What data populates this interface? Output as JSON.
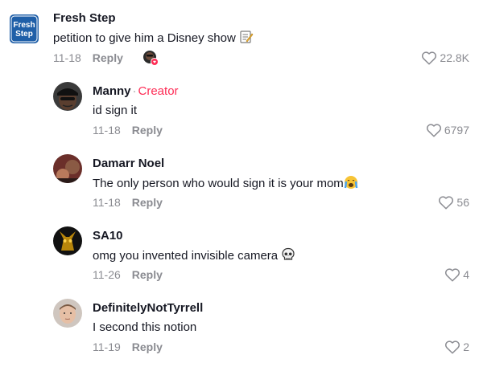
{
  "comments": [
    {
      "user": "Fresh Step",
      "avatar": "fresh-step-logo",
      "logo_text": [
        "Fresh",
        "Step"
      ],
      "text": "petition to give him a Disney show",
      "emoji": "memo-emoji",
      "date": "11-18",
      "reply_label": "Reply",
      "likes": "22.8K",
      "liked_by_creator": true
    },
    {
      "user": "Manny",
      "badge_sep": "·",
      "badge": "Creator",
      "text": "id sign it",
      "date": "11-18",
      "reply_label": "Reply",
      "likes": "6797"
    },
    {
      "user": "Damarr Noel",
      "text": "The only person who would sign it is your mom",
      "emoji": "crying-face-emoji",
      "date": "11-18",
      "reply_label": "Reply",
      "likes": "56"
    },
    {
      "user": "SA10",
      "text": "omg you invented invisible camera",
      "emoji": "skull-emoji",
      "date": "11-26",
      "reply_label": "Reply",
      "likes": "4"
    },
    {
      "user": "DefinitelyNotTyrrell",
      "text": "I second this notion",
      "date": "11-19",
      "reply_label": "Reply",
      "likes": "2"
    }
  ],
  "colors": {
    "creator_badge": "#fe2c55",
    "meta_gray": "#8a8b91",
    "fresh_step_blue": "#1f5fa8"
  }
}
